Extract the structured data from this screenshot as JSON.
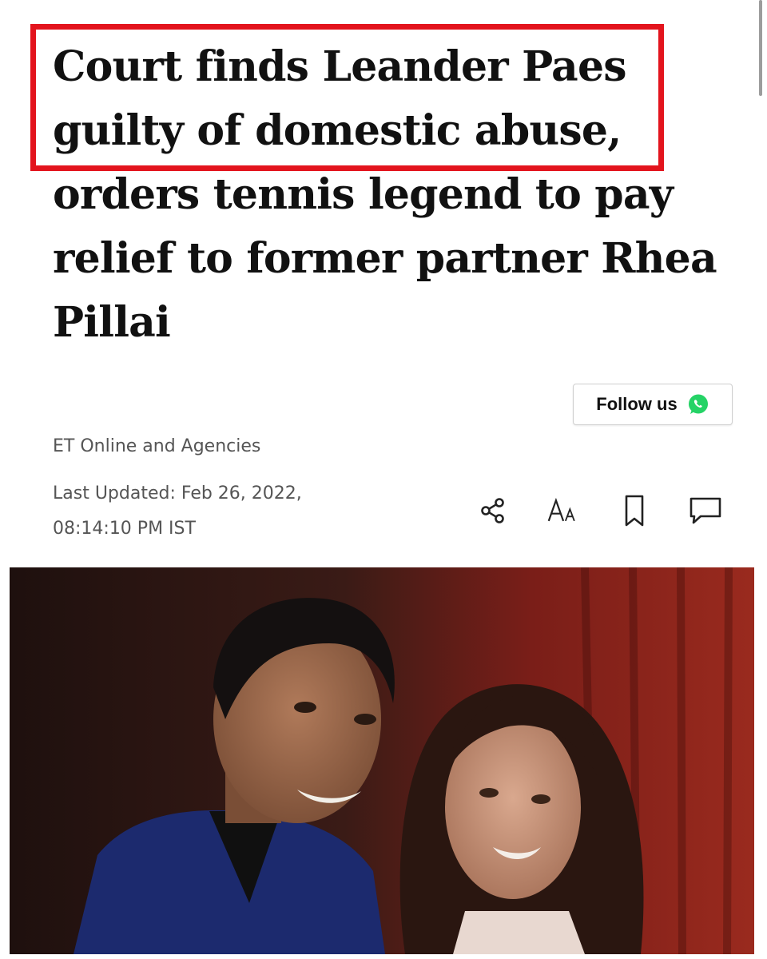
{
  "article": {
    "headline": "Court finds Leander Paes guilty of domestic abuse, orders tennis legend to pay relief to former partner Rhea Pillai",
    "author": "ET Online and Agencies",
    "last_updated_line1": "Last Updated: Feb 26, 2022,",
    "last_updated_line2": "08:14:10 PM IST"
  },
  "follow": {
    "label": "Follow us",
    "icon": "whatsapp-icon"
  },
  "toolbar": {
    "icons": [
      "share-icon",
      "font-size-icon",
      "bookmark-icon",
      "comment-icon"
    ],
    "font_size_glyph": "AA"
  },
  "colors": {
    "highlight": "#e3141d",
    "whatsapp": "#25d366",
    "meta_text": "#555555"
  }
}
